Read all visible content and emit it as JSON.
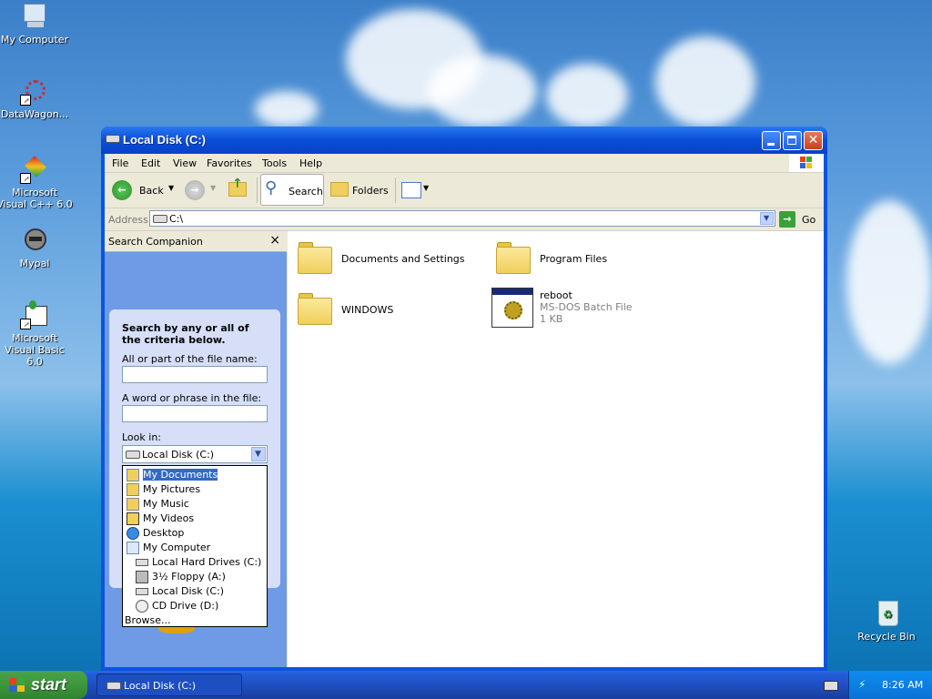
{
  "desktop": {
    "icons": [
      {
        "label": "My Computer",
        "icon": "my-computer-icon"
      },
      {
        "label": "DataWagon...",
        "icon": "datawagon-icon"
      },
      {
        "label": "Microsoft Visual C++ 6.0",
        "icon": "visual-cpp-icon"
      },
      {
        "label": "Mypal",
        "icon": "mypal-icon"
      },
      {
        "label": "Microsoft Visual Basic 6.0",
        "icon": "visual-basic-icon"
      },
      {
        "label": "Recycle Bin",
        "icon": "recycle-bin-icon"
      }
    ]
  },
  "window": {
    "title": "Local Disk (C:)",
    "menu": [
      "File",
      "Edit",
      "View",
      "Favorites",
      "Tools",
      "Help"
    ],
    "toolbar": {
      "back": "Back",
      "search": "Search",
      "folders": "Folders"
    },
    "address": {
      "label": "Address",
      "value": "C:\\",
      "go": "Go"
    },
    "search_companion": {
      "title": "Search Companion",
      "close": "×",
      "heading": "Search by any or all of the criteria below.",
      "filename_label": "All or part of the file name:",
      "phrase_label": "A word or phrase in the file:",
      "lookin_label": "Look in:",
      "lookin_value": "Local Disk (C:)",
      "options": [
        {
          "label": "My Documents",
          "icon": "my-documents-icon",
          "indent": 0,
          "selected": true
        },
        {
          "label": "My Pictures",
          "icon": "my-pictures-icon",
          "indent": 0
        },
        {
          "label": "My Music",
          "icon": "my-music-icon",
          "indent": 0
        },
        {
          "label": "My Videos",
          "icon": "my-videos-icon",
          "indent": 0
        },
        {
          "label": "Desktop",
          "icon": "desktop-icon",
          "indent": 0
        },
        {
          "label": "My Computer",
          "icon": "my-computer-icon",
          "indent": 0
        },
        {
          "label": "Local Hard Drives (C:)",
          "icon": "hard-drive-icon",
          "indent": 1
        },
        {
          "label": "3½ Floppy (A:)",
          "icon": "floppy-icon",
          "indent": 1
        },
        {
          "label": "Local Disk (C:)",
          "icon": "hard-drive-icon",
          "indent": 1
        },
        {
          "label": "CD Drive (D:)",
          "icon": "cd-drive-icon",
          "indent": 1
        },
        {
          "label": "Browse...",
          "icon": "",
          "indent": 0
        }
      ]
    },
    "files": [
      {
        "name": "Documents and Settings",
        "type": "folder"
      },
      {
        "name": "Program Files",
        "type": "folder"
      },
      {
        "name": "WINDOWS",
        "type": "folder"
      },
      {
        "name": "reboot",
        "type": "batch",
        "subtype": "MS-DOS Batch File",
        "size": "1 KB"
      }
    ]
  },
  "taskbar": {
    "start": "start",
    "task": "Local Disk (C:)",
    "time": "8:26 AM"
  }
}
